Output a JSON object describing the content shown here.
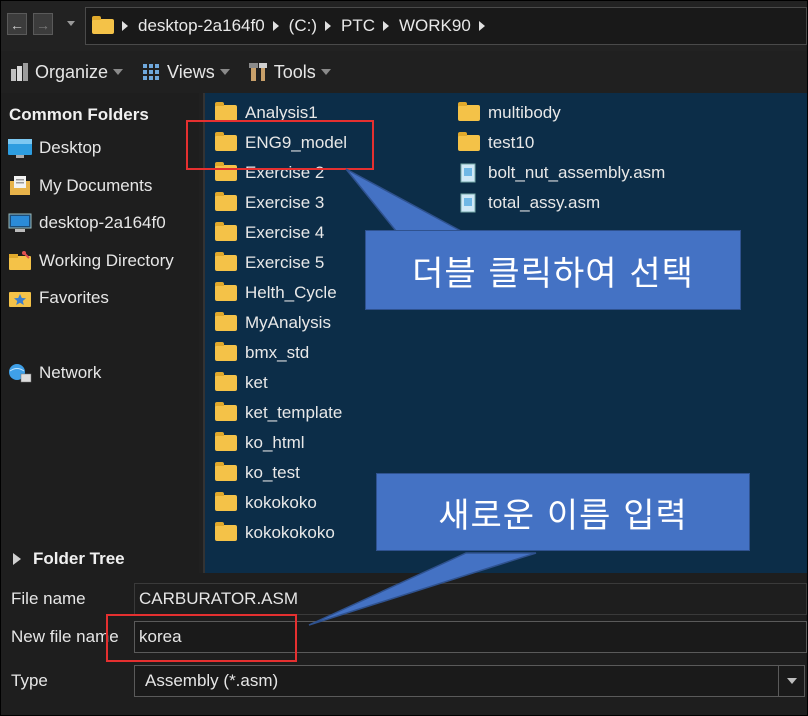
{
  "nav": {
    "back_icon": "back-arrow-icon",
    "forward_icon": "forward-arrow-icon"
  },
  "address": {
    "breadcrumbs": [
      "desktop-2a164f0",
      "(C:)",
      "PTC",
      "WORK90"
    ]
  },
  "toolbar": {
    "organize_label": "Organize",
    "views_label": "Views",
    "tools_label": "Tools"
  },
  "sidebar": {
    "header": "Common Folders",
    "items": [
      {
        "label": "Desktop",
        "icon": "desktop-icon"
      },
      {
        "label": "My Documents",
        "icon": "documents-icon"
      },
      {
        "label": "desktop-2a164f0",
        "icon": "computer-icon"
      },
      {
        "label": "Working Directory",
        "icon": "working-directory-icon"
      },
      {
        "label": "Favorites",
        "icon": "favorites-icon"
      },
      {
        "label": "Network",
        "icon": "network-icon"
      }
    ],
    "folder_tree_label": "Folder Tree"
  },
  "files": {
    "column1": [
      "Analysis1",
      "ENG9_model",
      "Exercise 2",
      "Exercise 3",
      "Exercise 4",
      "Exercise 5",
      "Helth_Cycle",
      "MyAnalysis",
      "bmx_std",
      "ket",
      "ket_template",
      "ko_html",
      "ko_test",
      "kokokoko",
      "kokokokoko"
    ],
    "column2_folders": [
      "multibody",
      "test10"
    ],
    "column2_files": [
      "bolt_nut_assembly.asm",
      "total_assy.asm"
    ]
  },
  "form": {
    "file_name_label": "File name",
    "file_name_value": "CARBURATOR.ASM",
    "new_file_name_label": "New file name",
    "new_file_name_value": "korea",
    "type_label": "Type",
    "type_value": "Assembly (*.asm)"
  },
  "annotations": {
    "callout_select": "더블 클릭하여 선택",
    "callout_rename": "새로운 이름 입력"
  },
  "colors": {
    "highlight_red": "#e53030",
    "callout_blue": "#4472c4",
    "file_pane_bg": "#0c2d48"
  }
}
